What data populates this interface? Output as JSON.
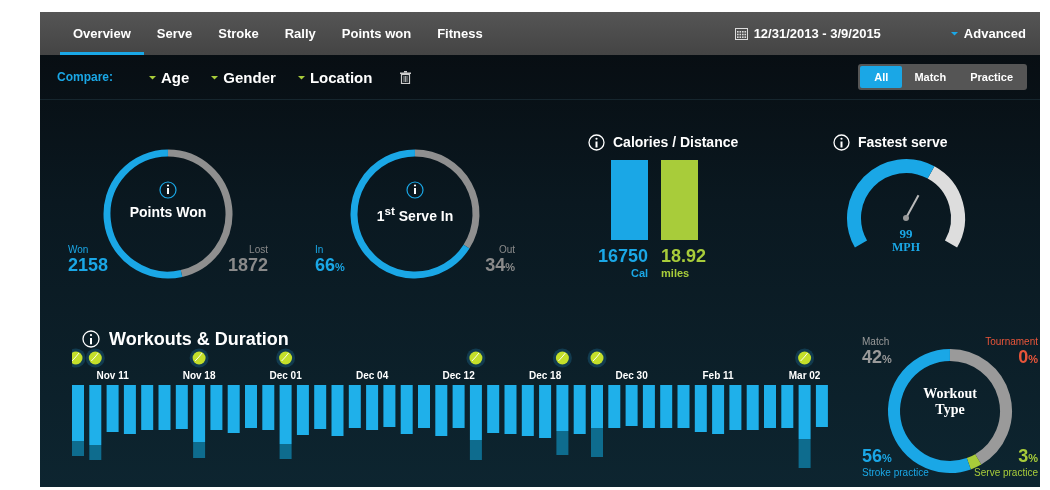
{
  "nav": {
    "tabs": [
      {
        "label": "Overview",
        "selected": true
      },
      {
        "label": "Serve",
        "selected": false
      },
      {
        "label": "Stroke",
        "selected": false
      },
      {
        "label": "Rally",
        "selected": false
      },
      {
        "label": "Points won",
        "selected": false
      },
      {
        "label": "Fitness",
        "selected": false
      }
    ],
    "date_range": "12/31/2013 - 3/9/2015",
    "advanced": "Advanced"
  },
  "compare": {
    "label": "Compare:",
    "filters": [
      "Age",
      "Gender",
      "Location"
    ],
    "modes": [
      {
        "label": "All",
        "selected": true
      },
      {
        "label": "Match",
        "selected": false
      },
      {
        "label": "Practice",
        "selected": false
      }
    ]
  },
  "rings": [
    {
      "title": "Points Won",
      "left": {
        "label": "Won",
        "value": "2158"
      },
      "right": {
        "label": "Lost",
        "value": "1872"
      }
    },
    {
      "title": "1$^{st}$ Serve In",
      "left": {
        "label": "In",
        "value": "66",
        "unit": "%"
      },
      "right": {
        "label": "Out",
        "value": "34",
        "unit": "%"
      }
    }
  ],
  "calories": {
    "title": "Calories / Distance",
    "items": [
      {
        "value": "16750",
        "unit": "Cal",
        "color": "#1aa7e6"
      },
      {
        "value": "18.92",
        "unit": "miles",
        "color": "#a8cc3a"
      }
    ]
  },
  "fastest_serve": {
    "title": "Fastest serve",
    "value": "99",
    "unit": "MPH"
  },
  "workouts": {
    "title": "Workouts & Duration",
    "date_labels": [
      "Nov 11",
      "Nov 18",
      "Dec 01",
      "Dec 04",
      "Dec 12",
      "Dec 18",
      "Dec 30",
      "Feb 11",
      "Mar 02"
    ]
  },
  "workout_type": {
    "title": "Workout Type",
    "segments": [
      {
        "label": "Match",
        "value": "42",
        "unit": "%",
        "color": "#9a9a9a"
      },
      {
        "label": "Tournament",
        "value": "0",
        "unit": "%",
        "color": "#e8553a"
      },
      {
        "label": "Stroke practice",
        "value": "56",
        "unit": "%",
        "color": "#1aa7e6"
      },
      {
        "label": "Serve practice",
        "value": "3",
        "unit": "%",
        "color": "#a8cc3a"
      }
    ]
  }
}
